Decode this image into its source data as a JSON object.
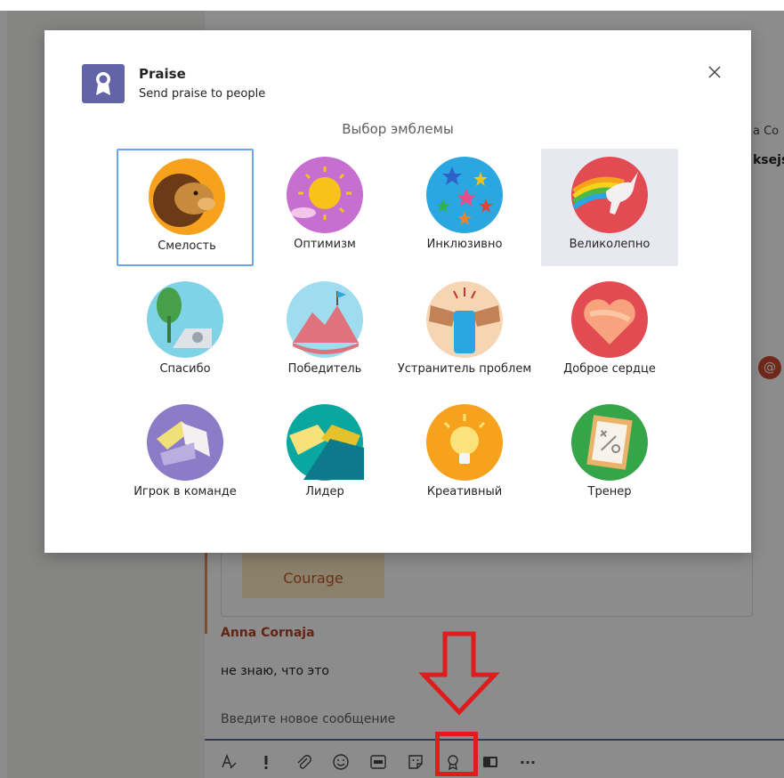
{
  "background_chat": {
    "cut_name_1": "a Co",
    "cut_name_2": "ksejs",
    "mention_symbol": "@",
    "card_badge_label": "Courage",
    "message_author": "Anna Cornaja",
    "message_text": "не знаю, что это",
    "compose_placeholder": "Введите новое сообщение",
    "toolbar_icons": [
      "format-icon",
      "important-icon",
      "attach-icon",
      "emoji-icon",
      "gif-icon",
      "sticker-icon",
      "praise-icon",
      "meet-icon",
      "more-icon"
    ],
    "more_label": "···"
  },
  "dialog": {
    "app_title": "Praise",
    "app_subtitle": "Send praise to people",
    "heading": "Выбор эмблемы",
    "close_icon": "close-icon",
    "badges": [
      {
        "label": "Смелость",
        "icon": "lion-icon",
        "state": "selected"
      },
      {
        "label": "Оптимизм",
        "icon": "sun-icon",
        "state": ""
      },
      {
        "label": "Инклюзивно",
        "icon": "stars-icon",
        "state": ""
      },
      {
        "label": "Великолепно",
        "icon": "unicorn-icon",
        "state": "hover"
      },
      {
        "label": "Спасибо",
        "icon": "thanks-icon",
        "state": ""
      },
      {
        "label": "Победитель",
        "icon": "mountain-flag-icon",
        "state": ""
      },
      {
        "label": "Устранитель проблем",
        "icon": "fist-icon",
        "state": ""
      },
      {
        "label": "Доброе сердце",
        "icon": "heart-hands-icon",
        "state": ""
      },
      {
        "label": "Игрок в команде",
        "icon": "team-hands-icon",
        "state": ""
      },
      {
        "label": "Лидер",
        "icon": "handshake-icon",
        "state": ""
      },
      {
        "label": "Креативный",
        "icon": "lightbulb-icon",
        "state": ""
      },
      {
        "label": "Тренер",
        "icon": "clipboard-icon",
        "state": ""
      }
    ]
  },
  "colors": {
    "brand": "#6264a7",
    "annotation_red": "#e01b1b",
    "selected_border": "#6ba4f0"
  }
}
